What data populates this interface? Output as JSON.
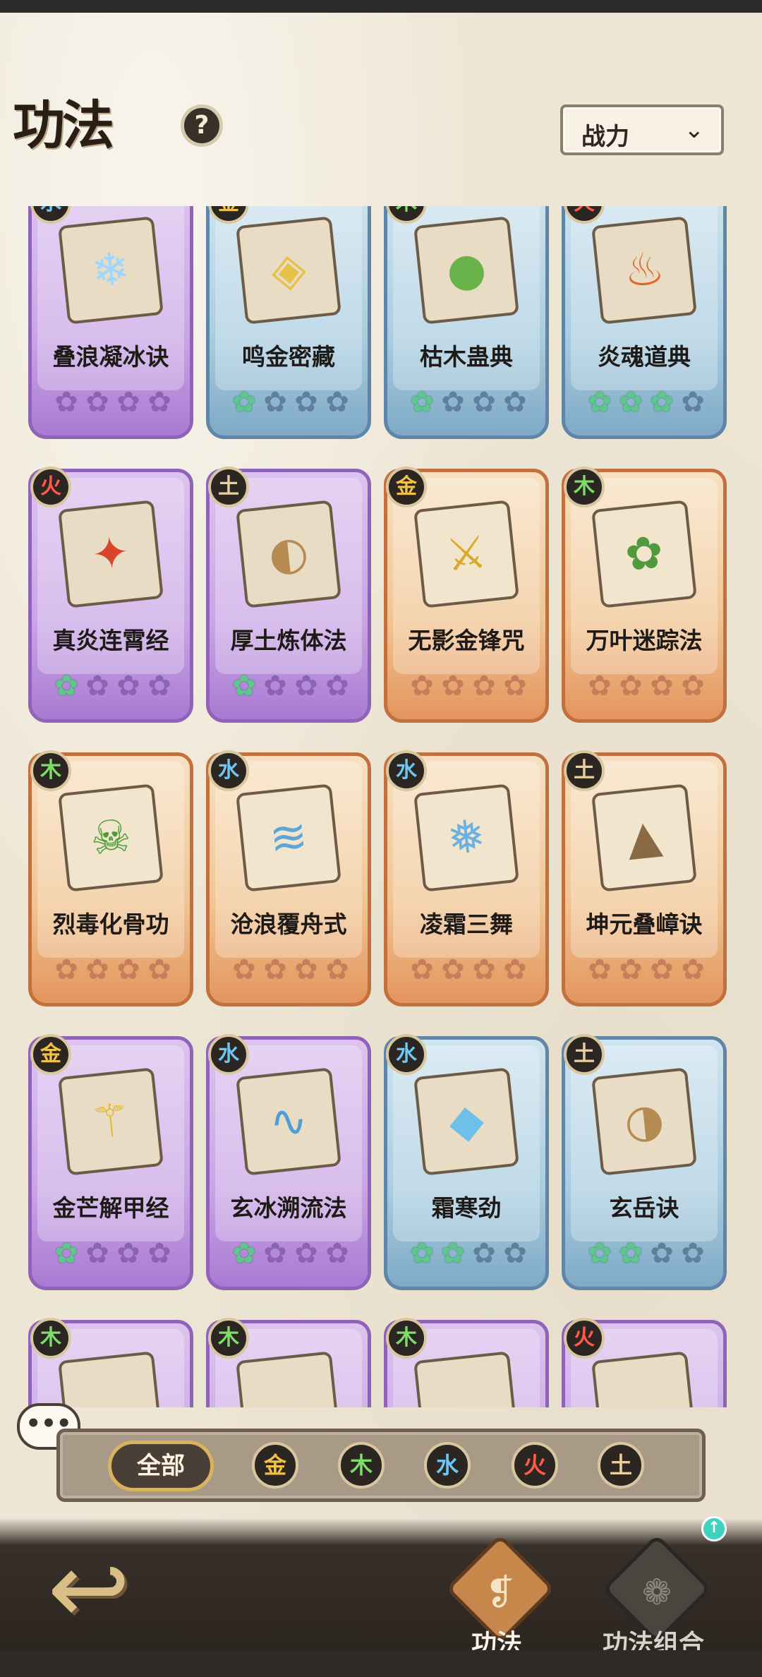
{
  "header": {
    "title": "功法",
    "help_label": "?",
    "sort_label": "战力",
    "sort_chevron": "⌄"
  },
  "element_colors": {
    "金": "#f0c24a",
    "木": "#7fdc6a",
    "水": "#6fc6f2",
    "火": "#ff5a4a",
    "土": "#e9cfa0"
  },
  "cards": [
    {
      "element": "水",
      "name": "叠浪凝冰诀",
      "rarity": "purple",
      "glyph": "❄",
      "glyph_color": "#9fd6ff",
      "stars": [
        0,
        0,
        0,
        0
      ]
    },
    {
      "element": "金",
      "name": "鸣金密藏",
      "rarity": "blue",
      "glyph": "◈",
      "glyph_color": "#e6c14a",
      "stars": [
        1,
        0,
        0,
        0
      ]
    },
    {
      "element": "木",
      "name": "枯木蛊典",
      "rarity": "blue",
      "glyph": "●",
      "glyph_color": "#6ab34a",
      "stars": [
        1,
        0,
        0,
        0
      ]
    },
    {
      "element": "火",
      "name": "炎魂道典",
      "rarity": "blue",
      "glyph": "♨",
      "glyph_color": "#e0662e",
      "stars": [
        1,
        1,
        1,
        0
      ]
    },
    {
      "element": "火",
      "name": "真炎连霄经",
      "rarity": "purple",
      "glyph": "✦",
      "glyph_color": "#d8452a",
      "stars": [
        1,
        0,
        0,
        0
      ]
    },
    {
      "element": "土",
      "name": "厚土炼体法",
      "rarity": "purple",
      "glyph": "◐",
      "glyph_color": "#b58b52",
      "stars": [
        1,
        0,
        0,
        0
      ]
    },
    {
      "element": "金",
      "name": "无影金锋咒",
      "rarity": "orange",
      "glyph": "⚔",
      "glyph_color": "#d9a82c",
      "stars": [
        0,
        0,
        0,
        0
      ]
    },
    {
      "element": "木",
      "name": "万叶迷踪法",
      "rarity": "orange",
      "glyph": "✿",
      "glyph_color": "#4f9a3c",
      "stars": [
        0,
        0,
        0,
        0
      ]
    },
    {
      "element": "木",
      "name": "烈毒化骨功",
      "rarity": "orange",
      "glyph": "☠",
      "glyph_color": "#4c9a38",
      "stars": [
        0,
        0,
        0,
        0
      ]
    },
    {
      "element": "水",
      "name": "沧浪覆舟式",
      "rarity": "orange",
      "glyph": "≋",
      "glyph_color": "#5aa6d8",
      "stars": [
        0,
        0,
        0,
        0
      ]
    },
    {
      "element": "水",
      "name": "凌霜三舞",
      "rarity": "orange",
      "glyph": "❅",
      "glyph_color": "#6ab0e0",
      "stars": [
        0,
        0,
        0,
        0
      ]
    },
    {
      "element": "土",
      "name": "坤元叠嶂诀",
      "rarity": "orange",
      "glyph": "▲",
      "glyph_color": "#8a6a44",
      "stars": [
        0,
        0,
        0,
        0
      ]
    },
    {
      "element": "金",
      "name": "金芒解甲经",
      "rarity": "purple",
      "glyph": "⚚",
      "glyph_color": "#e2b93a",
      "stars": [
        1,
        0,
        0,
        0
      ]
    },
    {
      "element": "水",
      "name": "玄冰溯流法",
      "rarity": "purple",
      "glyph": "∿",
      "glyph_color": "#4f9ed6",
      "stars": [
        1,
        0,
        0,
        0
      ]
    },
    {
      "element": "水",
      "name": "霜寒劲",
      "rarity": "blue",
      "glyph": "◆",
      "glyph_color": "#6fc0e8",
      "stars": [
        1,
        1,
        0,
        0
      ]
    },
    {
      "element": "土",
      "name": "玄岳诀",
      "rarity": "blue",
      "glyph": "◑",
      "glyph_color": "#b58b52",
      "stars": [
        1,
        1,
        0,
        0
      ]
    },
    {
      "element": "木",
      "name": "",
      "rarity": "purple",
      "glyph": "",
      "glyph_color": "#000000",
      "stars": [
        0,
        0,
        0,
        0
      ]
    },
    {
      "element": "木",
      "name": "",
      "rarity": "purple",
      "glyph": "",
      "glyph_color": "#000000",
      "stars": [
        0,
        0,
        0,
        0
      ]
    },
    {
      "element": "木",
      "name": "",
      "rarity": "purple",
      "glyph": "",
      "glyph_color": "#000000",
      "stars": [
        0,
        0,
        0,
        0
      ]
    },
    {
      "element": "火",
      "name": "",
      "rarity": "purple",
      "glyph": "",
      "glyph_color": "#000000",
      "stars": [
        0,
        0,
        0,
        0
      ]
    }
  ],
  "filter": {
    "chat_label": "•••",
    "all_label": "全部",
    "elements": [
      "金",
      "木",
      "水",
      "火",
      "土"
    ]
  },
  "nav": {
    "back_glyph": "↩",
    "tabs": [
      {
        "label": "功法",
        "glyph": "❡",
        "active": true
      },
      {
        "label": "功法组合",
        "glyph": "❁",
        "active": false
      }
    ],
    "notif_glyph": "↑"
  }
}
